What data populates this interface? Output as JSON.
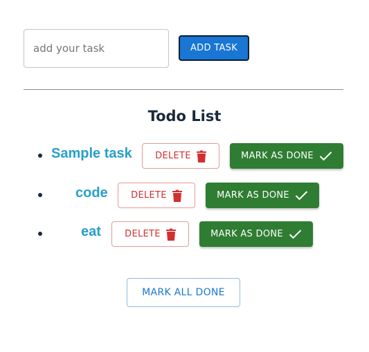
{
  "input": {
    "placeholder": "add your task",
    "value": ""
  },
  "add_button": {
    "label": "ADD TASK"
  },
  "list_title": "Todo List",
  "todos": [
    {
      "label": "Sample task",
      "delete_label": "DELETE",
      "done_label": "MARK AS DONE"
    },
    {
      "label": "code",
      "delete_label": "DELETE",
      "done_label": "MARK AS DONE"
    },
    {
      "label": "eat",
      "delete_label": "DELETE",
      "done_label": "MARK AS DONE"
    }
  ],
  "mark_all_button": {
    "label": "MARK ALL DONE"
  },
  "colors": {
    "primary": "#1976d2",
    "task_text": "#26a0c9",
    "delete": "#d32f2f",
    "done": "#2e7d32"
  },
  "icons": {
    "delete": "trash-icon",
    "done": "checkmark-icon"
  }
}
